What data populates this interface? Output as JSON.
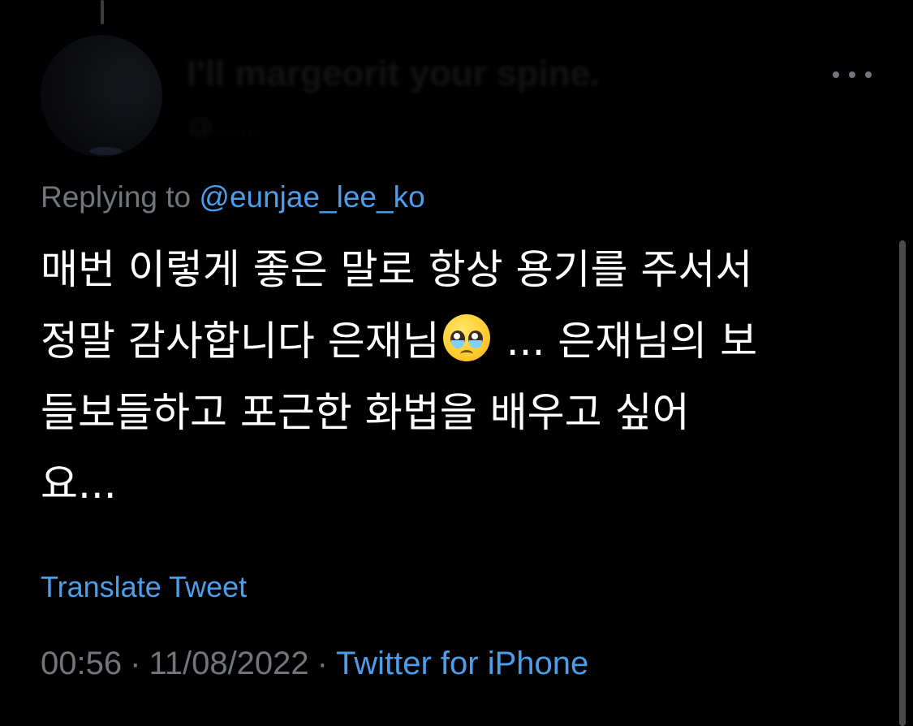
{
  "author": {
    "display_name": "I'll margeorit your spine.",
    "handle": "@.......",
    "more_label": "More"
  },
  "reply": {
    "prefix": "Replying to ",
    "mention": "@eunjae_lee_ko"
  },
  "tweet": {
    "lines": [
      "매번 이렇게 좋은 말로 항상 용기를 주서서",
      "정말 감사합니다 은재님",
      " ... 은재님의 보",
      "들보들하고 포근한 화법을 배우고 싶어",
      "요..."
    ],
    "emoji": "pleading-face"
  },
  "translate_label": "Translate Tweet",
  "meta": {
    "time": "00:56",
    "separator": "·",
    "date": "11/08/2022",
    "source": "Twitter for iPhone"
  },
  "colors": {
    "background": "#000000",
    "text": "#ffffff",
    "muted": "#71767b",
    "link": "#4c9eeb"
  }
}
